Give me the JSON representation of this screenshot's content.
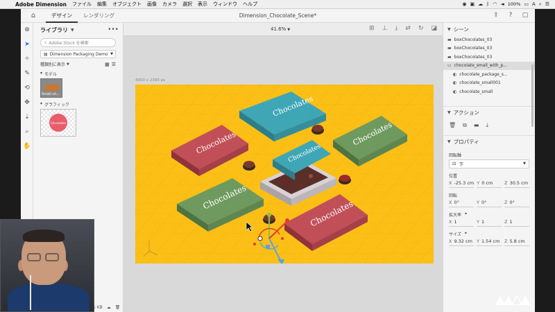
{
  "menubar": {
    "app_name": "Adobe Dimension",
    "menus": [
      "ファイル",
      "編集",
      "オブジェクト",
      "画像",
      "カメラ",
      "選択",
      "表示",
      "ウィンドウ",
      "ヘルプ"
    ],
    "battery": "100%"
  },
  "appbar": {
    "tabs": [
      "デザイン",
      "レンダリング"
    ],
    "active_tab": "デザイン",
    "document_title": "Dimension_Chocolate_Scene*"
  },
  "library": {
    "title": "ライブラリ",
    "search_placeholder": "Adobe Stock を検索",
    "library_select": "Dimension Packaging Demo",
    "view_label": "種類別に表示",
    "section_models": "モデル",
    "model_thumb_label": "Small ch...",
    "section_graphics": "グラフィック",
    "graphic_thumb_text": "Chocolates",
    "footer_size": "1 KB"
  },
  "viewport": {
    "zoom": "41.6%",
    "canvas_size_label": "4000 x 2390 px",
    "box_label": "Chocolates",
    "canvas_color": "#fbbf16"
  },
  "scene": {
    "title": "シーン",
    "items": [
      {
        "label": "boxChocolates_03",
        "type": "folder",
        "selected": false,
        "child": false
      },
      {
        "label": "boxChocolates_03",
        "type": "folder",
        "selected": false,
        "child": false
      },
      {
        "label": "boxChocolates_03",
        "type": "folder",
        "selected": false,
        "child": false
      },
      {
        "label": "chocolate_small_with_p...",
        "type": "folder-open",
        "selected": true,
        "child": false
      },
      {
        "label": "chocolate_package_s...",
        "type": "object",
        "selected": false,
        "child": true
      },
      {
        "label": "chocolate_small001",
        "type": "object",
        "selected": false,
        "child": true
      },
      {
        "label": "chocolate_small",
        "type": "object",
        "selected": false,
        "child": true
      }
    ]
  },
  "actions": {
    "title": "アクション"
  },
  "properties": {
    "title": "プロパティ",
    "pivot_label": "回転軸",
    "pivot_value": "下",
    "position_label": "位置",
    "position": {
      "x": "-25.3 cm",
      "y": "0 cm",
      "z": "30.5 cm"
    },
    "rotation_label": "回転",
    "rotation": {
      "x": "0°",
      "y": "0°",
      "z": "0°"
    },
    "scale_label": "拡大率",
    "scale": {
      "x": "1",
      "y": "1",
      "z": "1"
    },
    "size_label": "サイズ",
    "size": {
      "x": "9.32 cm",
      "y": "1.54 cm",
      "z": "5.8 cm"
    }
  },
  "colors": {
    "box_red": "#c14f58",
    "box_teal": "#3fa6b5",
    "box_green": "#6f9a5f",
    "accent_blue": "#1473e6"
  }
}
